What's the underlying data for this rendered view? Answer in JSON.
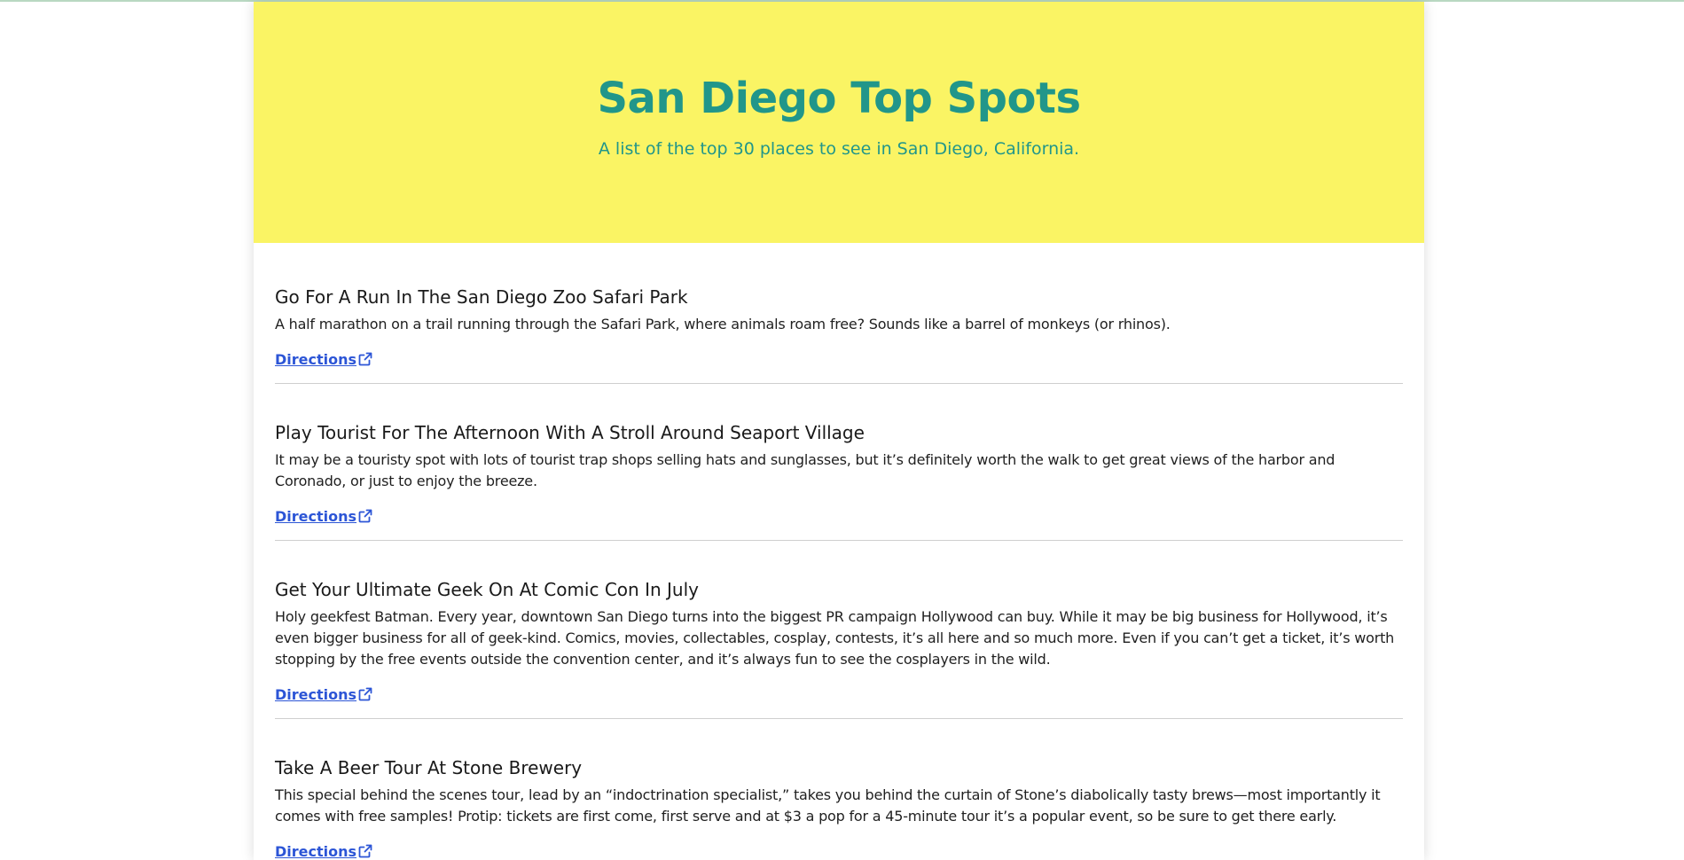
{
  "hero": {
    "title": "San Diego Top Spots",
    "subtitle": "A list of the top 30 places to see in San Diego, California."
  },
  "spots": [
    {
      "title": "Go For A Run In The San Diego Zoo Safari Park",
      "description": "A half marathon on a trail running through the Safari Park, where animals roam free? Sounds like a barrel of monkeys (or rhinos).",
      "link_label": "Directions"
    },
    {
      "title": "Play Tourist For The Afternoon With A Stroll Around Seaport Village",
      "description": "It may be a touristy spot with lots of tourist trap shops selling hats and sunglasses, but it’s definitely worth the walk to get great views of the harbor and Coronado, or just to enjoy the breeze.",
      "link_label": "Directions"
    },
    {
      "title": "Get Your Ultimate Geek On At Comic Con In July",
      "description": "Holy geekfest Batman. Every year, downtown San Diego turns into the biggest PR campaign Hollywood can buy. While it may be big business for Hollywood, it’s even bigger business for all of geek-kind. Comics, movies, collectables, cosplay, contests, it’s all here and so much more. Even if you can’t get a ticket, it’s worth stopping by the free events outside the convention center, and it’s always fun to see the cosplayers in the wild.",
      "link_label": "Directions"
    },
    {
      "title": "Take A Beer Tour At Stone Brewery",
      "description": "This special behind the scenes tour, lead by an “indoctrination specialist,” takes you behind the curtain of Stone’s diabolically tasty brews—most importantly it comes with free samples! Protip: tickets are first come, first serve and at $3 a pop for a 45-minute tour it’s a popular event, so be sure to get there early.",
      "link_label": "Directions"
    }
  ],
  "icons": {
    "link_icon": "external-link-icon"
  },
  "colors": {
    "hero_background": "#faf464",
    "hero_text": "#21968a",
    "link": "#2c55d6"
  }
}
